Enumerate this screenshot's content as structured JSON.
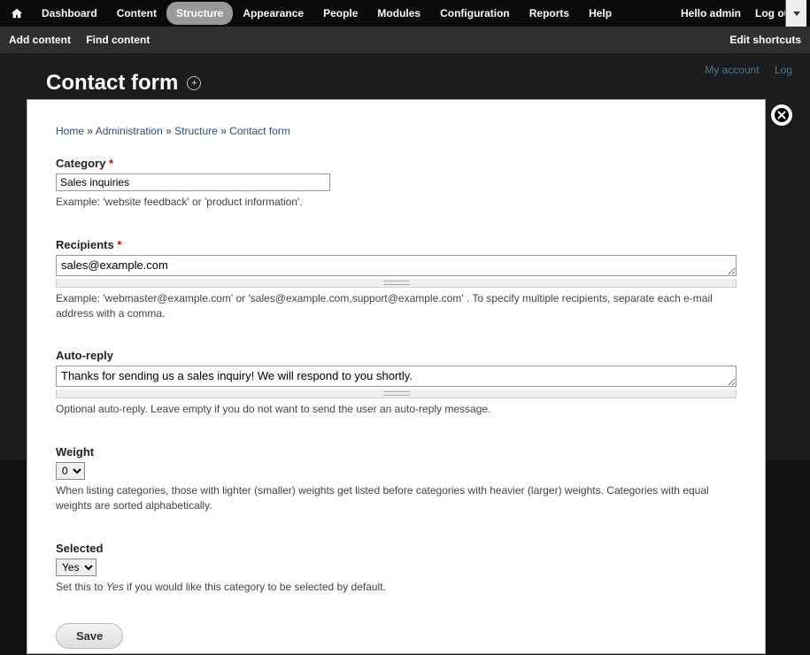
{
  "admin_menu": {
    "items": [
      "Dashboard",
      "Content",
      "Structure",
      "Appearance",
      "People",
      "Modules",
      "Configuration",
      "Reports",
      "Help"
    ],
    "active_index": 2,
    "hello_prefix": "Hello ",
    "hello_user": "admin",
    "logout": "Log out"
  },
  "shortcuts": {
    "add": "Add content",
    "find": "Find content",
    "edit": "Edit shortcuts"
  },
  "bg": {
    "links": [
      "My account",
      "Log"
    ],
    "title": ""
  },
  "overlay": {
    "title": "Contact form",
    "breadcrumb": [
      {
        "text": "Home",
        "link": true
      },
      {
        "text": "Administration",
        "link": true
      },
      {
        "text": "Structure",
        "link": true
      },
      {
        "text": "Contact form",
        "link": true
      }
    ]
  },
  "form": {
    "category": {
      "label": "Category",
      "value": "Sales inquiries",
      "help": "Example: 'website feedback' or 'product information'."
    },
    "recipients": {
      "label": "Recipients",
      "value": "sales@example.com",
      "help": "Example: 'webmaster@example.com' or 'sales@example.com,support@example.com' . To specify multiple recipients, separate each e-mail address with a comma."
    },
    "autoreply": {
      "label": "Auto-reply",
      "value": "Thanks for sending us a sales inquiry! We will respond to you shortly.",
      "help": "Optional auto-reply. Leave empty if you do not want to send the user an auto-reply message."
    },
    "weight": {
      "label": "Weight",
      "value": "0",
      "help": "When listing categories, those with lighter (smaller) weights get listed before categories with heavier (larger) weights. Categories with equal weights are sorted alphabetically."
    },
    "selected": {
      "label": "Selected",
      "value": "Yes",
      "help_prefix": "Set this to ",
      "help_em": "Yes",
      "help_suffix": " if you would like this category to be selected by default."
    },
    "save": "Save"
  }
}
